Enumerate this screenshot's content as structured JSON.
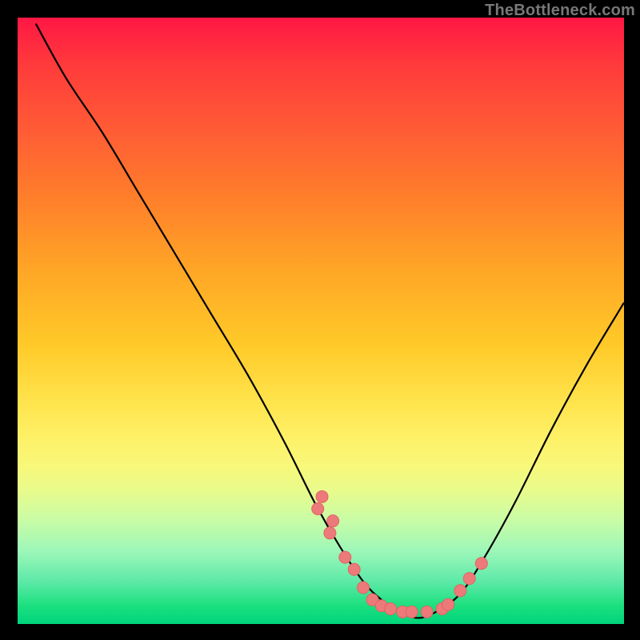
{
  "watermark": "TheBottleneck.com",
  "colors": {
    "background": "#000000",
    "curve_stroke": "#000000",
    "point_fill": "#ec7a7a",
    "point_stroke": "#e46363"
  },
  "chart_data": {
    "type": "line",
    "title": "",
    "xlabel": "",
    "ylabel": "",
    "xlim": [
      0,
      100
    ],
    "ylim": [
      0,
      100
    ],
    "grid": false,
    "series": [
      {
        "name": "bottleneck-curve",
        "x": [
          3,
          8,
          14,
          20,
          26,
          32,
          38,
          44,
          49,
          53,
          57,
          60,
          63,
          66,
          69,
          73,
          77,
          82,
          88,
          94,
          100
        ],
        "y": [
          99,
          90,
          81,
          71,
          61,
          51,
          41,
          30,
          20,
          13,
          7,
          4,
          2,
          1,
          2,
          5,
          11,
          20,
          32,
          43,
          53
        ]
      }
    ],
    "scatter": {
      "name": "sample-points",
      "x": [
        49.5,
        50.2,
        51.5,
        52.0,
        54.0,
        55.5,
        57.0,
        58.5,
        60.0,
        61.5,
        63.5,
        65.0,
        67.5,
        70.0,
        71.0,
        73.0,
        74.5,
        76.5
      ],
      "y": [
        19.0,
        21.0,
        15.0,
        17.0,
        11.0,
        9.0,
        6.0,
        4.0,
        3.0,
        2.5,
        2.0,
        2.0,
        2.0,
        2.5,
        3.2,
        5.5,
        7.5,
        10.0
      ]
    }
  }
}
